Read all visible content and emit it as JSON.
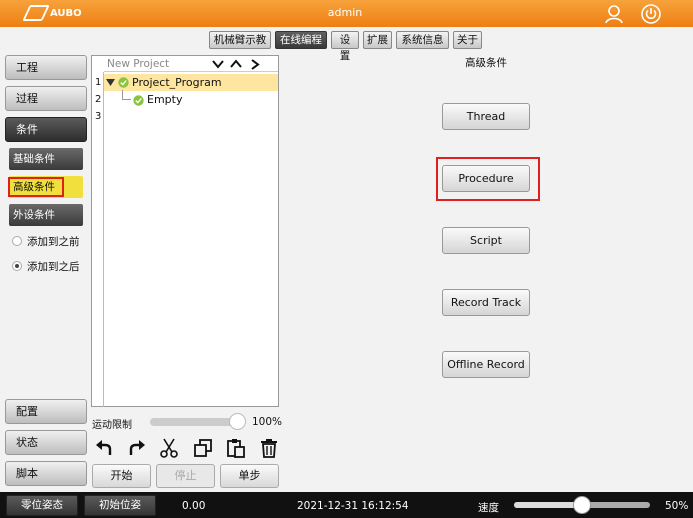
{
  "titlebar": {
    "brand": "AUBO",
    "title": "admin"
  },
  "tabs": [
    "机械臂示教",
    "在线编程",
    "设置",
    "扩展",
    "系统信息",
    "关于"
  ],
  "nav": {
    "project": "工程",
    "process": "过程",
    "condition": "条件",
    "config": "配置",
    "status": "状态",
    "script": "脚本"
  },
  "conditions": {
    "basic": "基础条件",
    "advanced": "高级条件",
    "peripheral": "外设条件",
    "add_before": "添加到之前",
    "add_after": "添加到之后"
  },
  "tree": {
    "header": "New Project",
    "line_numbers": [
      "1",
      "2",
      "3"
    ],
    "root": "Project_Program",
    "child": "Empty"
  },
  "motion": {
    "label": "运动限制",
    "value": "100%",
    "fraction": 1.0
  },
  "run": {
    "start": "开始",
    "stop": "停止",
    "step": "单步"
  },
  "panel": {
    "title": "高级条件",
    "buttons": [
      "Thread",
      "Procedure",
      "Script",
      "Record Track",
      "Offline Record"
    ]
  },
  "status": {
    "zero_pose": "零位姿态",
    "init_pose": "初始位姿",
    "value": "0.00",
    "datetime": "2021-12-31 16:12:54",
    "speed_label": "速度",
    "speed_value": "50%",
    "speed_fraction": 0.5
  },
  "colors": {
    "accent": "#f0921f",
    "highlight": "#e0201c",
    "selected": "#f0df3c"
  }
}
